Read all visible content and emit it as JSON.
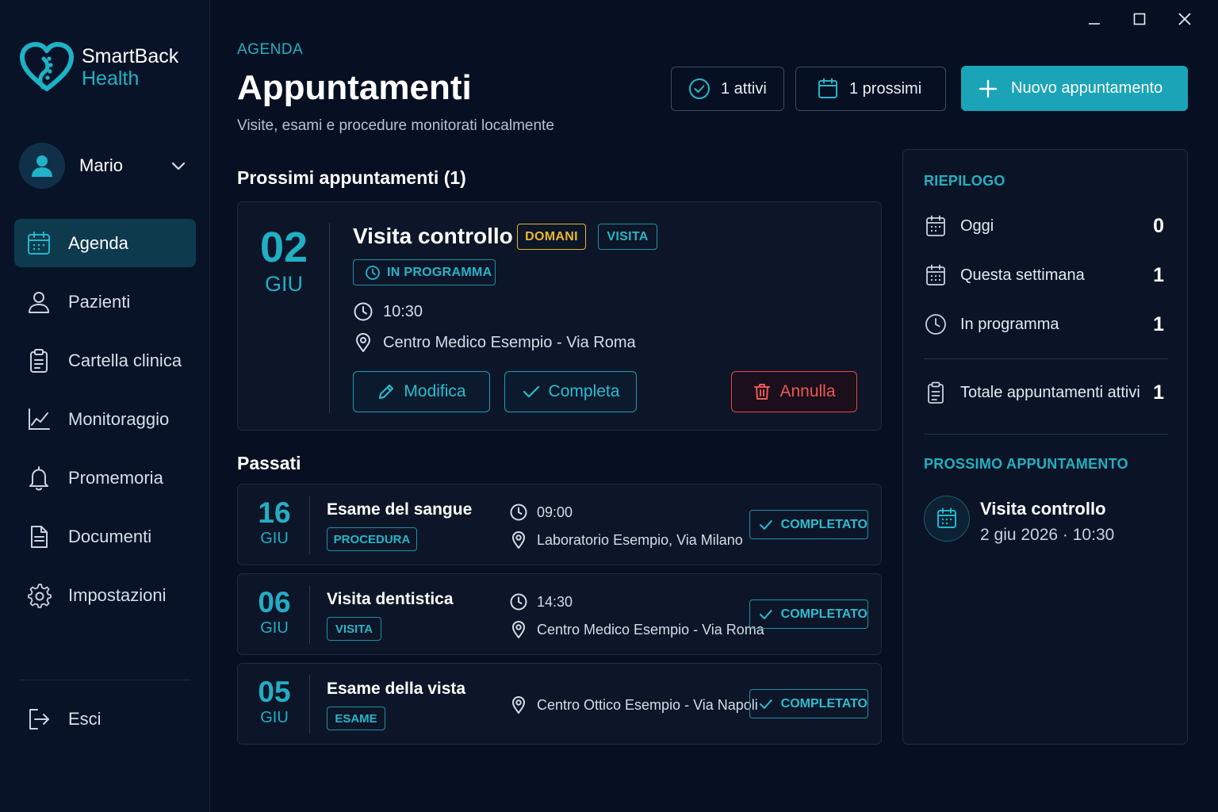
{
  "brand": {
    "name": "SmartBack",
    "sub": "Health"
  },
  "user": {
    "name": "Mario"
  },
  "sidebar": {
    "items": [
      {
        "label": "Agenda",
        "icon": "calendar-icon",
        "active": true
      },
      {
        "label": "Pazienti",
        "icon": "user-icon"
      },
      {
        "label": "Cartella clinica",
        "icon": "clipboard-icon"
      },
      {
        "label": "Monitoraggio",
        "icon": "chart-line-icon"
      },
      {
        "label": "Promemoria",
        "icon": "bell-icon"
      },
      {
        "label": "Documenti",
        "icon": "document-icon"
      },
      {
        "label": "Impostazioni",
        "icon": "gear-icon"
      }
    ],
    "logout": "Esci"
  },
  "header": {
    "eyebrow": "AGENDA",
    "title": "Appuntamenti",
    "subtitle": "Visite, esami e procedure monitorati localmente",
    "active_badge": "1 attivi",
    "upcoming_badge": "1 prossimi",
    "new_button": "Nuovo appuntamento"
  },
  "upcoming": {
    "heading": "Prossimi appuntamenti (1)",
    "card": {
      "day": "02",
      "month": "GIU",
      "title": "Visita controllo",
      "tag_when": "DOMANI",
      "tag_type": "VISITA",
      "status": "IN PROGRAMMA",
      "time": "10:30",
      "location": "Centro Medico Esempio - Via Roma",
      "edit_label": "Modifica",
      "complete_label": "Completa",
      "cancel_label": "Annulla"
    }
  },
  "past": {
    "heading": "Passati",
    "items": [
      {
        "day": "16",
        "month": "GIU",
        "title": "Esame del sangue",
        "tag": "PROCEDURA",
        "time": "09:00",
        "location": "Laboratorio Esempio, Via Milano",
        "status": "COMPLETATO"
      },
      {
        "day": "06",
        "month": "GIU",
        "title": "Visita dentistica",
        "tag": "VISITA",
        "time": "14:30",
        "location": "Centro Medico Esempio - Via Roma",
        "status": "COMPLETATO"
      },
      {
        "day": "05",
        "month": "GIU",
        "title": "Esame della vista",
        "tag": "ESAME",
        "location": "Centro Ottico Esempio - Via Napoli",
        "status": "COMPLETATO"
      }
    ]
  },
  "summary": {
    "heading": "RIEPILOGO",
    "rows": [
      {
        "label": "Oggi",
        "value": "0"
      },
      {
        "label": "Questa settimana",
        "value": "1"
      },
      {
        "label": "In programma",
        "value": "1"
      }
    ],
    "total": {
      "label": "Totale appuntamenti attivi",
      "value": "1"
    },
    "next_heading": "PROSSIMO APPUNTAMENTO",
    "next": {
      "title": "Visita controllo",
      "when": "2 giu 2026 · 10:30"
    }
  },
  "colors": {
    "accent": "#1ba4b8",
    "warning": "#eab72b",
    "danger": "#ec5858",
    "background": "#071022"
  }
}
